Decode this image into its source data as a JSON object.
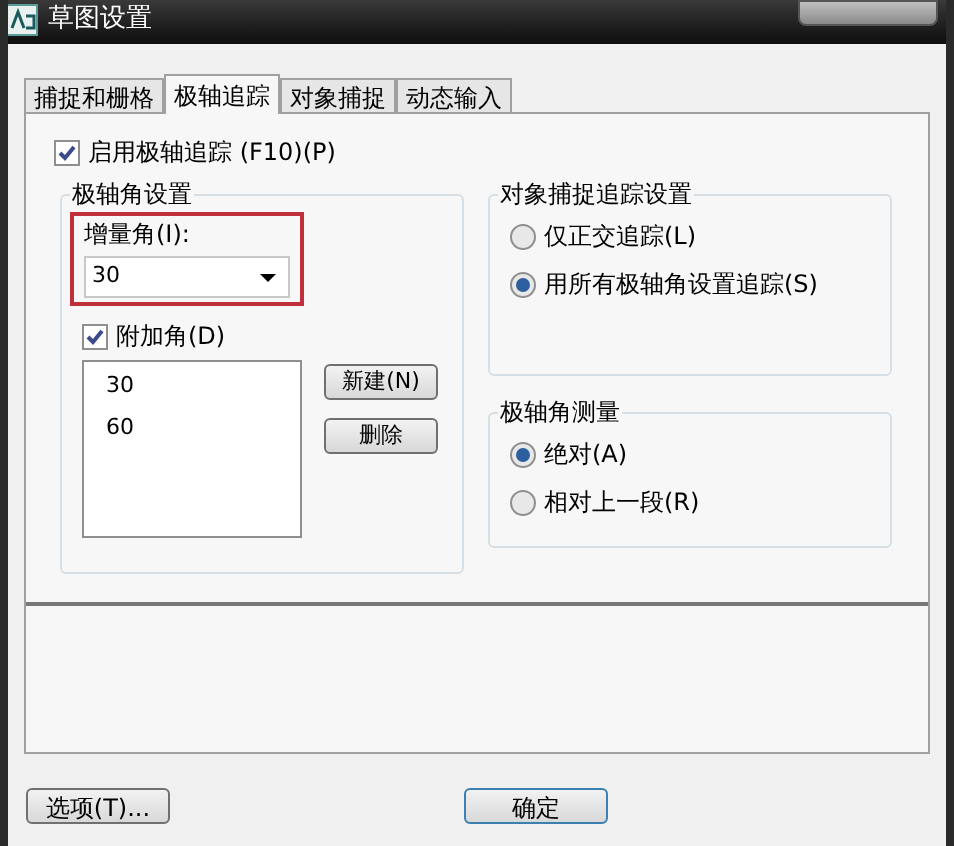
{
  "window": {
    "title": "草图设置"
  },
  "tabs": [
    {
      "label": "捕捉和栅格",
      "selected": false
    },
    {
      "label": "极轴追踪",
      "selected": true
    },
    {
      "label": "对象捕捉",
      "selected": false
    },
    {
      "label": "动态输入",
      "selected": false
    }
  ],
  "polar_tracking": {
    "label": "启用极轴追踪 (F10)(P)",
    "checked": true
  },
  "polar_angle_settings": {
    "title": "极轴角设置",
    "increment": {
      "label": "增量角(I):",
      "value": "30",
      "highlighted": true
    },
    "additional": {
      "label": "附加角(D)",
      "checked": true,
      "items": [
        "30",
        "60"
      ],
      "buttons": [
        "新建(N)",
        "删除"
      ]
    }
  },
  "snap_tracking": {
    "title": "对象捕捉追踪设置",
    "options": [
      {
        "label": "仅正交追踪(L)",
        "selected": false
      },
      {
        "label": "用所有极轴角设置追踪(S)",
        "selected": true
      }
    ]
  },
  "measurement": {
    "title": "极轴角测量",
    "options": [
      {
        "label": "绝对(A)",
        "selected": true
      },
      {
        "label": "相对上一段(R)",
        "selected": false
      }
    ]
  },
  "buttons": [
    {
      "label": "选项(T)...",
      "kind": "options"
    },
    {
      "label": "确定",
      "kind": "ok"
    }
  ]
}
